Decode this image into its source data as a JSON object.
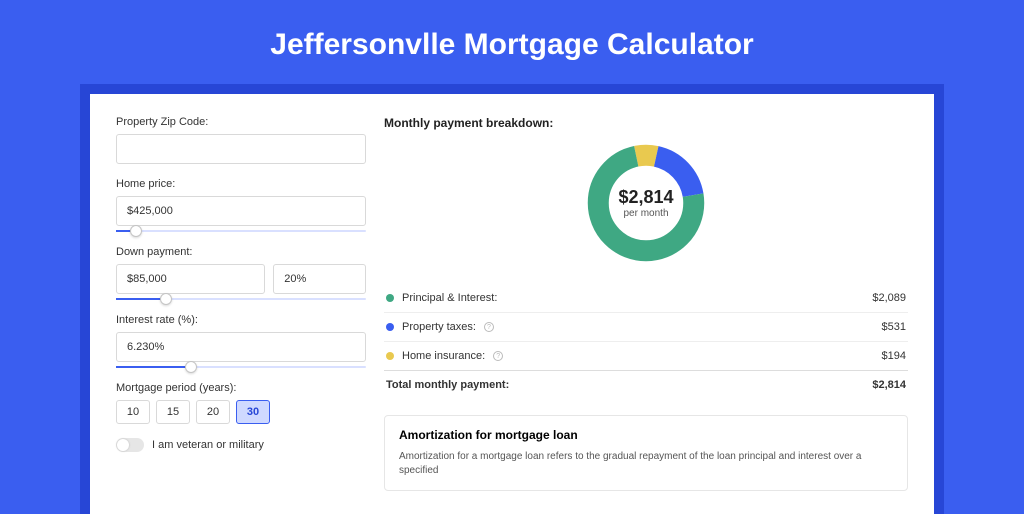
{
  "title": "Jeffersonvlle Mortgage Calculator",
  "colors": {
    "principal": "#3fa883",
    "taxes": "#3a5ef0",
    "insurance": "#e9c94f"
  },
  "form": {
    "zip": {
      "label": "Property Zip Code:",
      "value": ""
    },
    "home_price": {
      "label": "Home price:",
      "value": "$425,000",
      "slider_pct": 8
    },
    "down_payment": {
      "label": "Down payment:",
      "amount": "$85,000",
      "pct": "20%",
      "slider_pct": 20
    },
    "interest": {
      "label": "Interest rate (%):",
      "value": "6.230%",
      "slider_pct": 30
    },
    "period": {
      "label": "Mortgage period (years):",
      "options": [
        "10",
        "15",
        "20",
        "30"
      ],
      "selected": "30"
    },
    "veteran": {
      "label": "I am veteran or military",
      "on": false
    }
  },
  "breakdown": {
    "title": "Monthly payment breakdown:",
    "center_amount": "$2,814",
    "center_sub": "per month",
    "rows": [
      {
        "key": "pi",
        "label": "Principal & Interest:",
        "value": "$2,089",
        "color": "#3fa883",
        "info": false
      },
      {
        "key": "tax",
        "label": "Property taxes:",
        "value": "$531",
        "color": "#3a5ef0",
        "info": true
      },
      {
        "key": "ins",
        "label": "Home insurance:",
        "value": "$194",
        "color": "#e9c94f",
        "info": true
      }
    ],
    "total": {
      "label": "Total monthly payment:",
      "value": "$2,814"
    }
  },
  "chart_data": {
    "type": "pie",
    "title": "Monthly payment breakdown",
    "series": [
      {
        "name": "Principal & Interest",
        "value": 2089,
        "color": "#3fa883"
      },
      {
        "name": "Property taxes",
        "value": 531,
        "color": "#3a5ef0"
      },
      {
        "name": "Home insurance",
        "value": 194,
        "color": "#e9c94f"
      }
    ],
    "total": 2814,
    "center_label": "$2,814",
    "center_sub": "per month"
  },
  "amortization": {
    "title": "Amortization for mortgage loan",
    "text": "Amortization for a mortgage loan refers to the gradual repayment of the loan principal and interest over a specified"
  }
}
